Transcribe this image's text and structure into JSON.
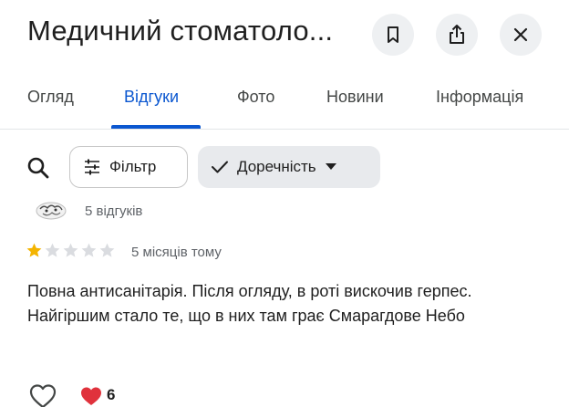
{
  "header": {
    "title": "Медичний стоматоло...",
    "save_icon": "bookmark-icon",
    "share_icon": "share-icon",
    "close_icon": "close-icon"
  },
  "tabs": [
    {
      "label": "Огляд",
      "active": false
    },
    {
      "label": "Відгуки",
      "active": true
    },
    {
      "label": "Фото",
      "active": false
    },
    {
      "label": "Новини",
      "active": false
    },
    {
      "label": "Інформація",
      "active": false
    }
  ],
  "toolbar": {
    "search_icon": "search-icon",
    "filter_label": "Фільтр",
    "sort_label": "Доречність"
  },
  "review": {
    "reviewer_reviews": "5 відгуків",
    "rating": 1,
    "max_rating": 5,
    "date": "5 місяців тому",
    "text": "Повна антисанітарія. Після огляду, в роті вискочив герпес. Найгіршим стало те, що в них там грає Смарагдове Небо"
  },
  "reactions": {
    "like_icon": "heart-outline-icon",
    "reaction_icon": "red-heart-icon",
    "reaction_count": "6"
  },
  "colors": {
    "accent": "#0b57d0",
    "star_filled": "#f4b400",
    "star_empty": "#dadce0",
    "heart": "#e0323c"
  }
}
